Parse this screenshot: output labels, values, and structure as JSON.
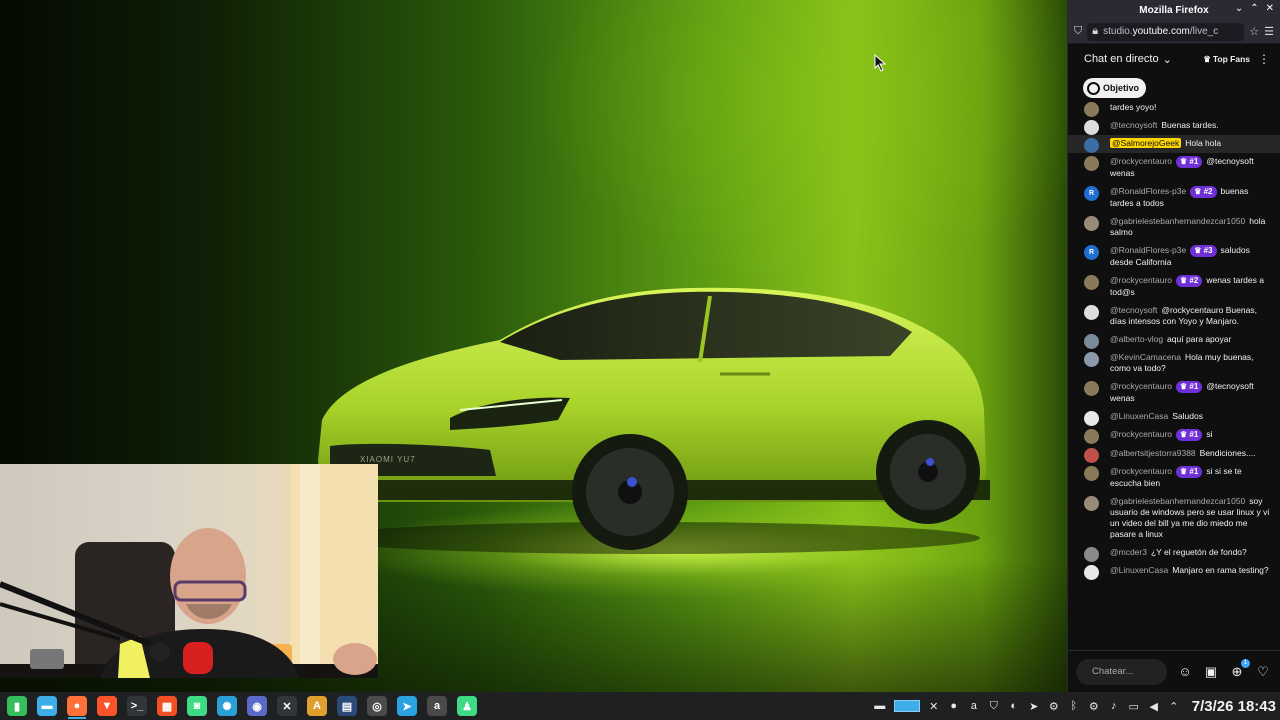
{
  "browser": {
    "window_title": "Mozilla Firefox",
    "url_prefix": "studio.",
    "url_domain": "youtube.com",
    "url_path": "/live_c"
  },
  "chat": {
    "title": "Chat en directo",
    "top_fans_label": "Top Fans",
    "goal_label": "Objetivo",
    "input_placeholder": "Chatear...",
    "notification_count": "1",
    "messages": [
      {
        "author": "",
        "badge": "",
        "text": "tardes yoyo!",
        "avatar_color": "#8a7a5a",
        "avatar_letter": ""
      },
      {
        "author": "@tecnoysoft",
        "badge": "",
        "text": "Buenas tardes.",
        "avatar_color": "#dddddd",
        "avatar_letter": ""
      },
      {
        "author": "@SalmorejoGeek",
        "badge": "",
        "text": "Hola hola",
        "avatar_color": "#3a6ea5",
        "avatar_letter": "",
        "owner": true
      },
      {
        "author": "@rockycentauro",
        "badge": "#1",
        "text": "@tecnoysoft wenas",
        "avatar_color": "#8a7a5a",
        "avatar_letter": ""
      },
      {
        "author": "@RonaldFlores-p3e",
        "badge": "#2",
        "text": "buenas tardes a todos",
        "avatar_color": "#1e6fd0",
        "avatar_letter": "R"
      },
      {
        "author": "@gabrielestebanhernandezcar1050",
        "badge": "",
        "text": "hola salmo",
        "avatar_color": "#9a8a7a",
        "avatar_letter": ""
      },
      {
        "author": "@RonaldFlores-p3e",
        "badge": "#3",
        "text": "saludos desde California",
        "avatar_color": "#1e6fd0",
        "avatar_letter": "R"
      },
      {
        "author": "@rockycentauro",
        "badge": "#2",
        "text": "wenas tardes a tod@s",
        "avatar_color": "#8a7a5a",
        "avatar_letter": ""
      },
      {
        "author": "@tecnoysoft",
        "badge": "",
        "text": "@rockycentauro Buenas, días intensos con Yoyo y Manjaro.",
        "avatar_color": "#dddddd",
        "avatar_letter": ""
      },
      {
        "author": "@alberto-vlog",
        "badge": "",
        "text": "aquí para apoyar",
        "avatar_color": "#7a8a9a",
        "avatar_letter": ""
      },
      {
        "author": "@KevinCamacena",
        "badge": "",
        "text": "Hola muy buenas, como va todo?",
        "avatar_color": "#8a9aaa",
        "avatar_letter": ""
      },
      {
        "author": "@rockycentauro",
        "badge": "#1",
        "text": "@tecnoysoft wenas",
        "avatar_color": "#8a7a5a",
        "avatar_letter": ""
      },
      {
        "author": "@LinuxenCasa",
        "badge": "",
        "text": "Saludos",
        "avatar_color": "#e8e8e8",
        "avatar_letter": ""
      },
      {
        "author": "@rockycentauro",
        "badge": "#1",
        "text": "si",
        "avatar_color": "#8a7a5a",
        "avatar_letter": ""
      },
      {
        "author": "@albertsitjestorra9388",
        "badge": "",
        "text": "Bendiciones....",
        "avatar_color": "#c0504a",
        "avatar_letter": ""
      },
      {
        "author": "@rockycentauro",
        "badge": "#1",
        "text": "si si se te escucha bien",
        "avatar_color": "#8a7a5a",
        "avatar_letter": ""
      },
      {
        "author": "@gabrielestebanhernandezcar1050",
        "badge": "",
        "text": "soy usuario de windows pero se usar linux y vi un video del bill ya me dio miedo me pasare a linux",
        "avatar_color": "#9a8a7a",
        "avatar_letter": ""
      },
      {
        "author": "@mcder3",
        "badge": "",
        "text": "¿Y el reguetón de fondo?",
        "avatar_color": "#8a8a8a",
        "avatar_letter": ""
      },
      {
        "author": "@LinuxenCasa",
        "badge": "",
        "text": "Manjaro en rama testing?",
        "avatar_color": "#e8e8e8",
        "avatar_letter": ""
      }
    ]
  },
  "wallpaper": {
    "car_badge": "XIAOMI YU7"
  },
  "taskbar": {
    "apps": [
      {
        "name": "manjaro-icon",
        "color": "#35bf5c",
        "glyph": "▮"
      },
      {
        "name": "files-icon",
        "color": "#3daee9",
        "glyph": "▬"
      },
      {
        "name": "firefox-icon",
        "color": "#ff7139",
        "glyph": "●",
        "active": true
      },
      {
        "name": "brave-icon",
        "color": "#fb542b",
        "glyph": "▼"
      },
      {
        "name": "terminal-icon",
        "color": "#31363b",
        "glyph": ">_"
      },
      {
        "name": "windows-apps-icon",
        "color": "#f25022",
        "glyph": "▦"
      },
      {
        "name": "android-icon",
        "color": "#3ddc84",
        "glyph": "◙"
      },
      {
        "name": "globe-icon",
        "color": "#2a9fd6",
        "glyph": "✺"
      },
      {
        "name": "ghost-icon",
        "color": "#5a6ac8",
        "glyph": "◉"
      },
      {
        "name": "network-tool-icon",
        "color": "#31363b",
        "glyph": "✕"
      },
      {
        "name": "text-editor-icon",
        "color": "#e0a030",
        "glyph": "A"
      },
      {
        "name": "system-monitor-icon",
        "color": "#2a4a7a",
        "glyph": "▤"
      },
      {
        "name": "obs-icon",
        "color": "#4a4a4a",
        "glyph": "◎"
      },
      {
        "name": "telegram-icon",
        "color": "#2aa3e0",
        "glyph": "➤"
      },
      {
        "name": "audio-app-icon",
        "color": "#4a4a4a",
        "glyph": "a"
      },
      {
        "name": "android-studio-icon",
        "color": "#3ddc84",
        "glyph": "♟"
      }
    ],
    "clock": "7/3/26 18:43"
  }
}
